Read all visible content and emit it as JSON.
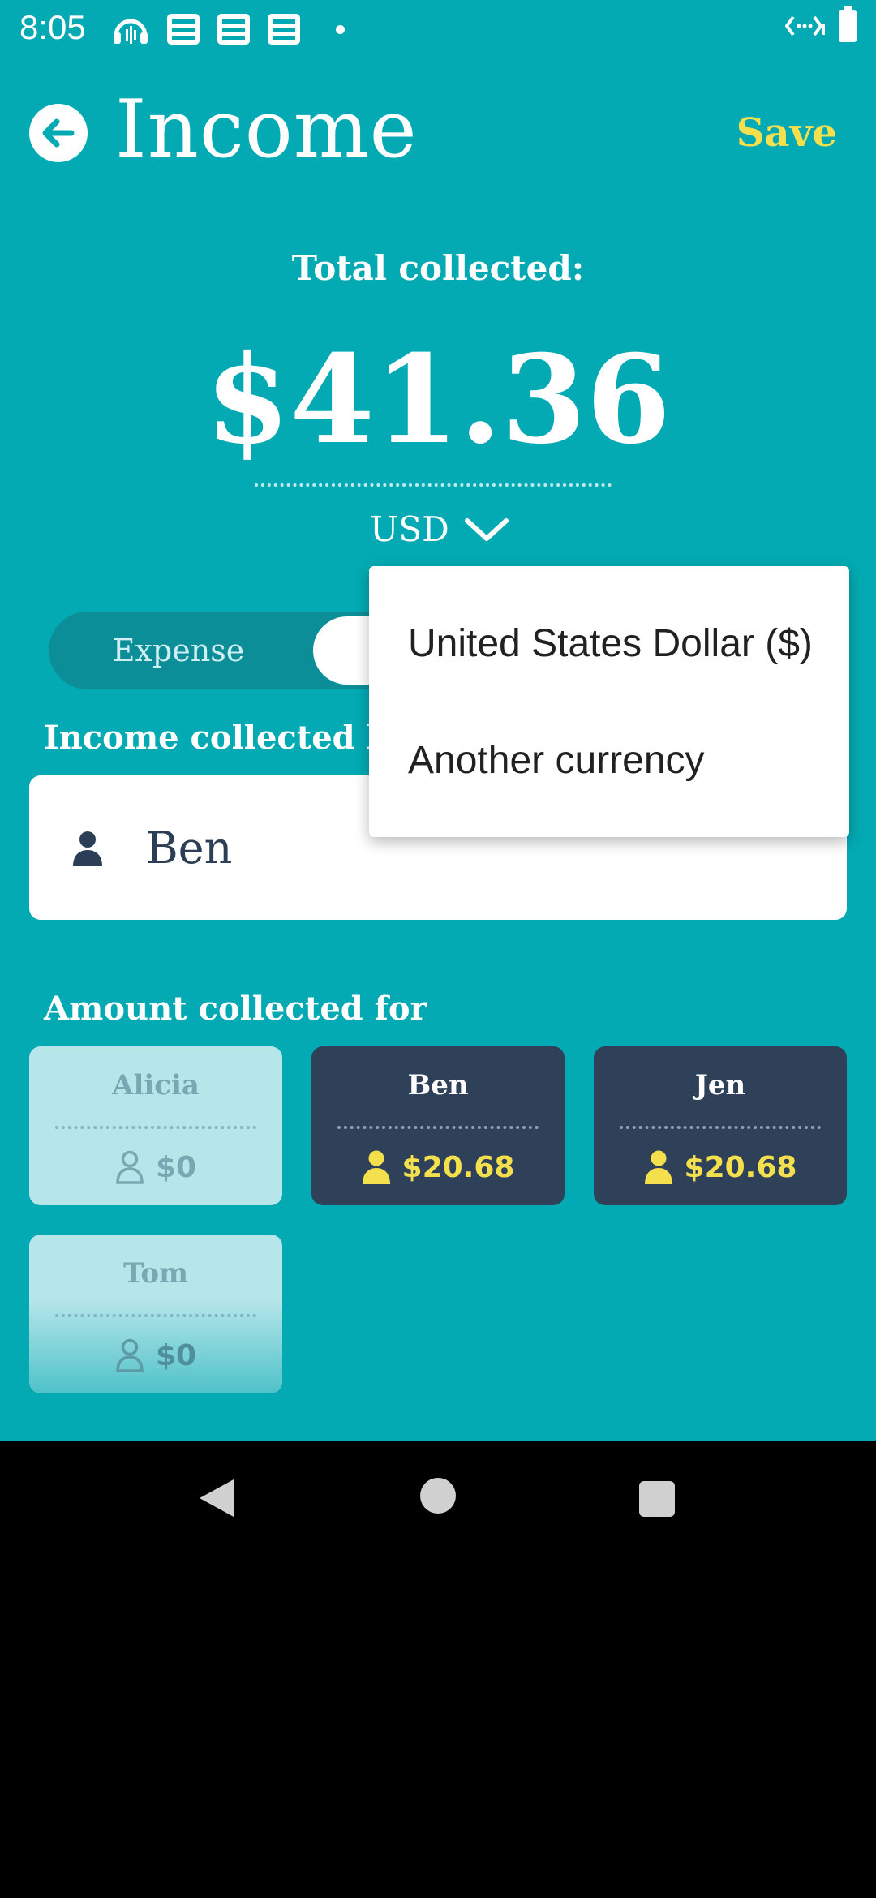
{
  "status_bar": {
    "time": "8:05",
    "icons": [
      "podcast-icon",
      "news-icon",
      "news-icon",
      "news-icon",
      "notification-dot",
      "data-saver-icon",
      "battery-icon"
    ]
  },
  "header": {
    "title": "Income",
    "save_label": "Save"
  },
  "total": {
    "label": "Total collected:",
    "amount": "$41.36",
    "currency": "USD"
  },
  "type_toggle": {
    "expense_label": "Expense"
  },
  "collected_by": {
    "label": "Income collected by",
    "person": "Ben"
  },
  "collected_for": {
    "label": "Amount collected for",
    "people": [
      {
        "name": "Alicia",
        "amount": "$0",
        "selected": false
      },
      {
        "name": "Ben",
        "amount": "$20.68",
        "selected": true
      },
      {
        "name": "Jen",
        "amount": "$20.68",
        "selected": true
      },
      {
        "name": "Tom",
        "amount": "$0",
        "selected": false
      }
    ]
  },
  "currency_menu": {
    "options": [
      "United States Dollar ($)",
      "Another currency"
    ]
  },
  "colors": {
    "background": "#03aab3",
    "accent": "#f4e04d",
    "tile_selected": "#2e4159",
    "tile_unselected": "#b7e6ea"
  }
}
